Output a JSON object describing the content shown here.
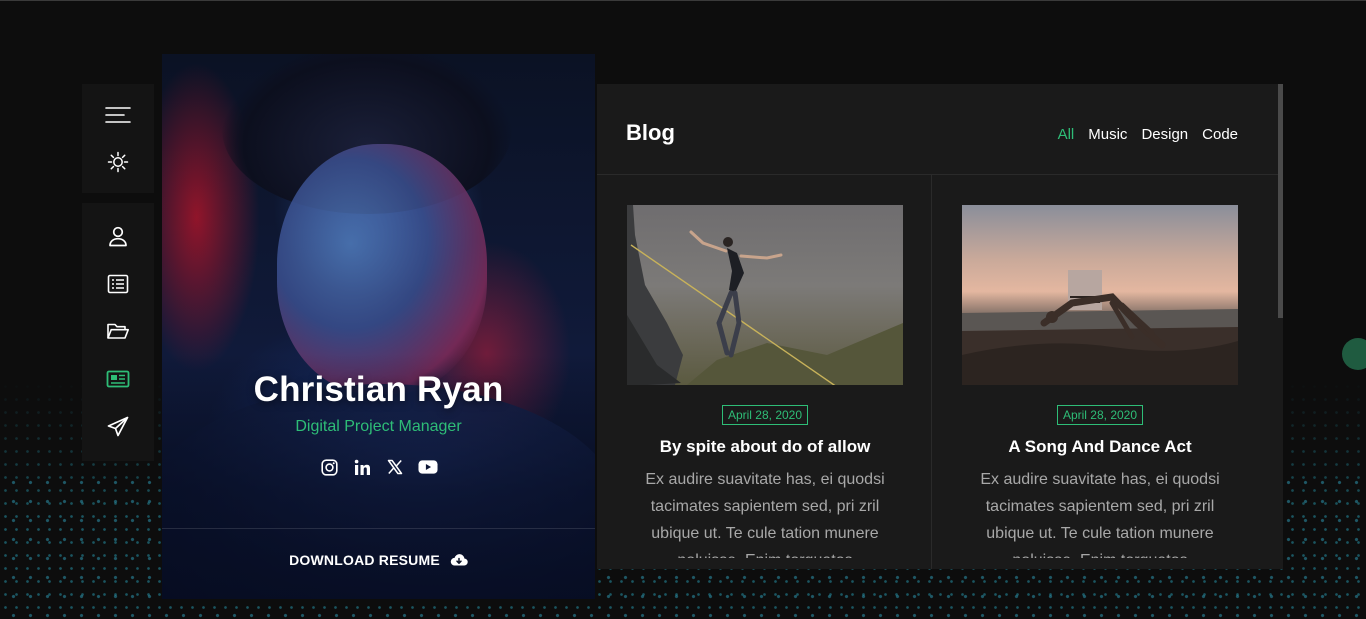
{
  "menu": {
    "top_items": [
      {
        "icon": "hamburger-icon"
      },
      {
        "icon": "sun-icon"
      }
    ],
    "nav_items": [
      {
        "icon": "user-icon",
        "active": false
      },
      {
        "icon": "list-icon",
        "active": false
      },
      {
        "icon": "folder-open-icon",
        "active": false
      },
      {
        "icon": "newspaper-icon",
        "active": true
      },
      {
        "icon": "paper-plane-icon",
        "active": false
      }
    ]
  },
  "profile": {
    "name": "Christian Ryan",
    "role": "Digital Project Manager",
    "social": [
      "instagram-icon",
      "linkedin-icon",
      "x-icon",
      "youtube-icon"
    ],
    "download_label": "DOWNLOAD RESUME"
  },
  "blog": {
    "title": "Blog",
    "filters": [
      {
        "label": "All",
        "active": true
      },
      {
        "label": "Music",
        "active": false
      },
      {
        "label": "Design",
        "active": false
      },
      {
        "label": "Code",
        "active": false
      }
    ],
    "posts": [
      {
        "date": "April 28, 2020",
        "title": "By spite about do of allow",
        "excerpt": "Ex audire suavitate has, ei quodsi tacimates sapientem sed, pri zril ubique ut. Te cule tation munere noluisse. Enim torquatos"
      },
      {
        "date": "April 28, 2020",
        "title": "A Song And Dance Act",
        "excerpt": "Ex audire suavitate has, ei quodsi tacimates sapientem sed, pri zril ubique ut. Te cule tation munere noluisse. Enim torquatos"
      }
    ]
  },
  "colors": {
    "accent": "#2ebd77",
    "background": "#0d0d0d",
    "panel": "#1a1a1a",
    "menu": "#141414"
  }
}
